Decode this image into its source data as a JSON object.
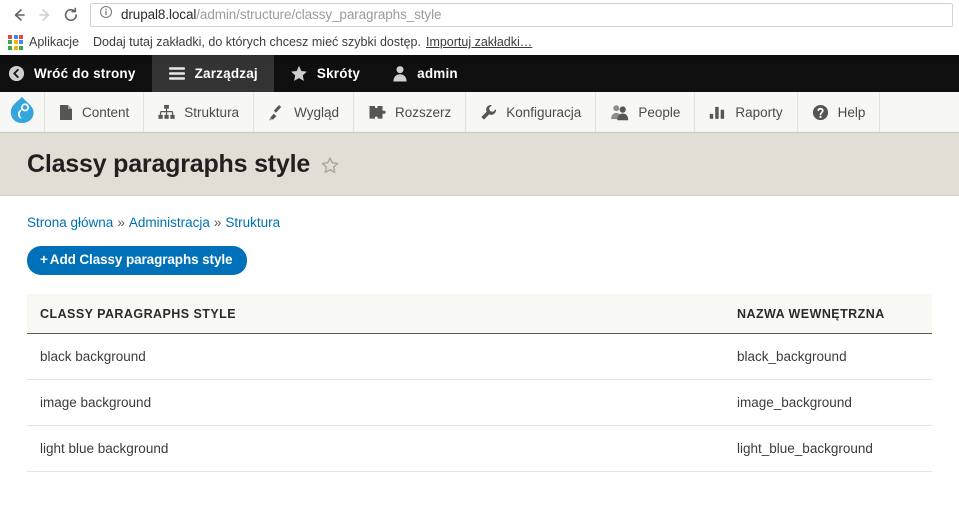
{
  "browser": {
    "back_icon": "arrow-left-icon",
    "forward_icon": "arrow-right-icon",
    "reload_icon": "reload-icon",
    "site_info_icon": "info-circle-icon",
    "url_host": "drupal8.local",
    "url_path": "/admin/structure/classy_paragraphs_style",
    "url_full": "drupal8.local/admin/structure/classy_paragraphs_style",
    "bookmarks": {
      "apps_icon": "apps-grid-icon",
      "apps_label": "Aplikacje",
      "hint": "Dodaj tutaj zakładki, do których chcesz mieć szybki dostęp.",
      "import_link": "Importuj zakładki…"
    }
  },
  "admin_toolbar": {
    "items": [
      {
        "label": "Wróć do strony",
        "icon": "back-circle-icon",
        "active": false
      },
      {
        "label": "Zarządzaj",
        "icon": "hamburger-icon",
        "active": true
      },
      {
        "label": "Skróty",
        "icon": "star-icon",
        "active": false
      },
      {
        "label": "admin",
        "icon": "user-icon",
        "active": false
      }
    ]
  },
  "menu_bar": {
    "logo_icon": "drupal-droplet-icon",
    "items": [
      {
        "label": "Content",
        "icon": "file-icon"
      },
      {
        "label": "Struktura",
        "icon": "sitemap-icon"
      },
      {
        "label": "Wygląd",
        "icon": "paintbrush-icon"
      },
      {
        "label": "Rozszerz",
        "icon": "puzzle-icon"
      },
      {
        "label": "Konfiguracja",
        "icon": "wrench-icon"
      },
      {
        "label": "People",
        "icon": "people-icon"
      },
      {
        "label": "Raporty",
        "icon": "bar-chart-icon"
      },
      {
        "label": "Help",
        "icon": "question-circle-icon"
      }
    ]
  },
  "page": {
    "title": "Classy paragraphs style",
    "favorite_icon": "star-outline-icon",
    "breadcrumb": [
      {
        "label": "Strona główna"
      },
      {
        "label": "Administracja"
      },
      {
        "label": "Struktura"
      }
    ],
    "breadcrumb_separator": "»",
    "add_button": {
      "plus": "+",
      "label": "Add Classy paragraphs style"
    },
    "table": {
      "headers": [
        "Classy paragraphs style",
        "Nazwa wewnętrzna"
      ],
      "rows": [
        {
          "label": "black background",
          "machine_name": "black_background"
        },
        {
          "label": "image background",
          "machine_name": "image_background"
        },
        {
          "label": "light blue background",
          "machine_name": "light_blue_background"
        }
      ]
    }
  },
  "colors": {
    "accent_blue": "#0071b8",
    "link_blue": "#0071b3",
    "toolbar_black": "#0f0f0f",
    "toolbar_active": "#333333",
    "title_band": "#e0ded5",
    "drupal_logo_blue": "#34a6dd"
  }
}
